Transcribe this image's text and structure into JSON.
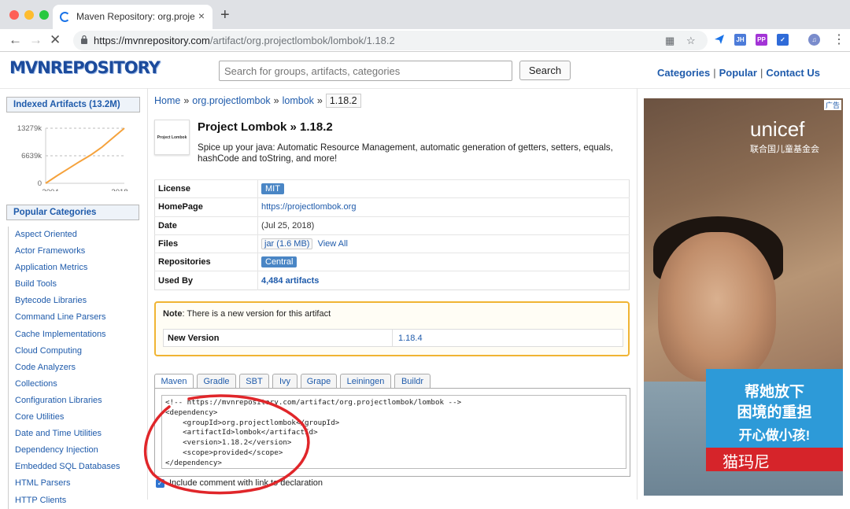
{
  "browser": {
    "tab_title": "Maven Repository: org.projectlombok",
    "tab_close": "×",
    "new_tab": "+",
    "url_host": "https://mvnrepository.com",
    "url_path": "/artifact/org.projectlombok/lombok/1.18.2",
    "ext_labels": [
      "JH",
      "PP"
    ]
  },
  "header": {
    "logo": "MVNREPOSITORY",
    "search_placeholder": "Search for groups, artifacts, categories",
    "search_button": "Search",
    "links": [
      "Categories",
      "Popular",
      "Contact Us"
    ],
    "link_sep": "|"
  },
  "sidebar": {
    "indexed_title": "Indexed Artifacts (13.2M)",
    "chart_data": {
      "type": "area",
      "x": [
        2004,
        2006,
        2008,
        2010,
        2012,
        2014,
        2016,
        2018
      ],
      "values": [
        0,
        1800,
        3500,
        5200,
        6800,
        8700,
        11000,
        13279
      ],
      "yticks": [
        "13279k",
        "6639k",
        "0"
      ],
      "xticks": [
        "2004",
        "2018"
      ]
    },
    "popular_title": "Popular Categories",
    "categories": [
      "Aspect Oriented",
      "Actor Frameworks",
      "Application Metrics",
      "Build Tools",
      "Bytecode Libraries",
      "Command Line Parsers",
      "Cache Implementations",
      "Cloud Computing",
      "Code Analyzers",
      "Collections",
      "Configuration Libraries",
      "Core Utilities",
      "Date and Time Utilities",
      "Dependency Injection",
      "Embedded SQL Databases",
      "HTML Parsers",
      "HTTP Clients"
    ]
  },
  "breadcrumb": {
    "items": [
      "Home",
      "org.projectlombok",
      "lombok"
    ],
    "sep": "»",
    "current": "1.18.2"
  },
  "project": {
    "logo_text": "Project Lombok",
    "title": "Project Lombok » 1.18.2",
    "description": "Spice up your java: Automatic Resource Management, automatic generation of getters, setters, equals, hashCode and toString, and more!"
  },
  "info": {
    "license_label": "License",
    "license_value": "MIT",
    "homepage_label": "HomePage",
    "homepage_value": "https://projectlombok.org",
    "date_label": "Date",
    "date_value": "(Jul 25, 2018)",
    "files_label": "Files",
    "files_jar": "jar (1.6 MB)",
    "files_viewall": "View All",
    "repos_label": "Repositories",
    "repos_value": "Central",
    "usedby_label": "Used By",
    "usedby_value": "4,484 artifacts"
  },
  "note": {
    "bold": "Note",
    "text": ": There is a new version for this artifact",
    "new_version_label": "New Version",
    "new_version_value": "1.18.4"
  },
  "build_tabs": [
    "Maven",
    "Gradle",
    "SBT",
    "Ivy",
    "Grape",
    "Leiningen",
    "Buildr"
  ],
  "snippet": "<!-- https://mvnrepository.com/artifact/org.projectlombok/lombok -->\n<dependency>\n    <groupId>org.projectlombok</groupId>\n    <artifactId>lombok</artifactId>\n    <version>1.18.2</version>\n    <scope>provided</scope>\n</dependency>",
  "include_comment": "Include comment with link to declaration",
  "ad": {
    "brand": "unicef",
    "brand_cn": "联合国儿童基金会",
    "tag": "广告",
    "line1": "帮她放下",
    "line2": "困境的重担",
    "line3": "开心做小孩!",
    "watermark": "猫玛尼"
  }
}
